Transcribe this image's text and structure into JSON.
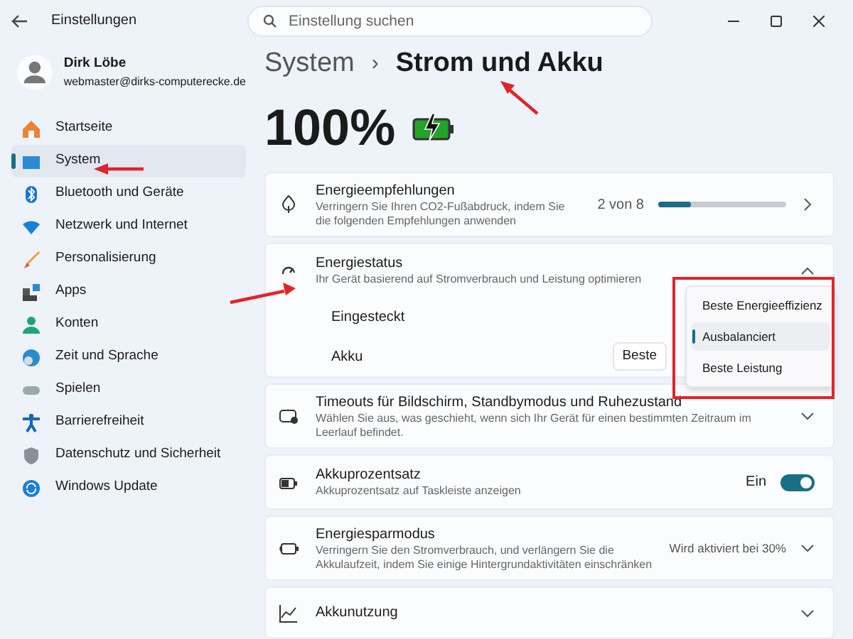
{
  "window": {
    "title": "Einstellungen"
  },
  "search": {
    "placeholder": "Einstellung suchen"
  },
  "user": {
    "name": "Dirk Löbe",
    "email": "webmaster@dirks-computerecke.de"
  },
  "nav": [
    {
      "label": "Startseite",
      "selected": false
    },
    {
      "label": "System",
      "selected": true
    },
    {
      "label": "Bluetooth und Geräte",
      "selected": false
    },
    {
      "label": "Netzwerk und Internet",
      "selected": false
    },
    {
      "label": "Personalisierung",
      "selected": false
    },
    {
      "label": "Apps",
      "selected": false
    },
    {
      "label": "Konten",
      "selected": false
    },
    {
      "label": "Zeit und Sprache",
      "selected": false
    },
    {
      "label": "Spielen",
      "selected": false
    },
    {
      "label": "Barrierefreiheit",
      "selected": false
    },
    {
      "label": "Datenschutz und Sicherheit",
      "selected": false
    },
    {
      "label": "Windows Update",
      "selected": false
    }
  ],
  "breadcrumb": {
    "parent": "System",
    "separator": "›",
    "current": "Strom und Akku"
  },
  "battery": {
    "percent": "100%",
    "charging": true
  },
  "cards": [
    {
      "kind": "progress",
      "title": "Energieempfehlungen",
      "description": "Verringern Sie Ihren CO2-Fußabdruck, indem Sie die folgenden Empfehlungen anwenden",
      "count": "2 von 8",
      "level": 0.25
    },
    {
      "kind": "mode",
      "title": "Energiestatus",
      "description": "Ihr Gerät basierend auf Stromverbrauch und Leistung optimieren",
      "expanded": true,
      "rows": [
        {
          "label": "Eingesteckt"
        },
        {
          "label": "Akku",
          "value": "Beste"
        }
      ],
      "options": [
        {
          "label": "Beste Energieeffizienz",
          "selected": false
        },
        {
          "label": "Ausbalanciert",
          "selected": true
        },
        {
          "label": "Beste Leistung",
          "selected": false
        }
      ]
    },
    {
      "kind": "expander",
      "title": "Timeouts für Bildschirm, Standbymodus und Ruhezustand",
      "description": "Wählen Sie aus, was geschieht, wenn sich Ihr Gerät für einen bestimmten Zeitraum im Leerlauf befindet.",
      "expanded": false
    },
    {
      "kind": "toggle",
      "title": "Akkuprozentsatz",
      "description": "Akkuprozentsatz auf Taskleiste anzeigen",
      "state_label": "Ein",
      "on": true
    },
    {
      "kind": "expander",
      "title": "Energiesparmodus",
      "description": "Verringern Sie den Stromverbrauch, und verlängern Sie die Akkulaufzeit, indem Sie einige Hintergrundaktivitäten einschränken",
      "value": "Wird aktiviert bei 30%",
      "expanded": false
    },
    {
      "kind": "expander",
      "title": "Akkunutzung",
      "expanded": false
    }
  ]
}
